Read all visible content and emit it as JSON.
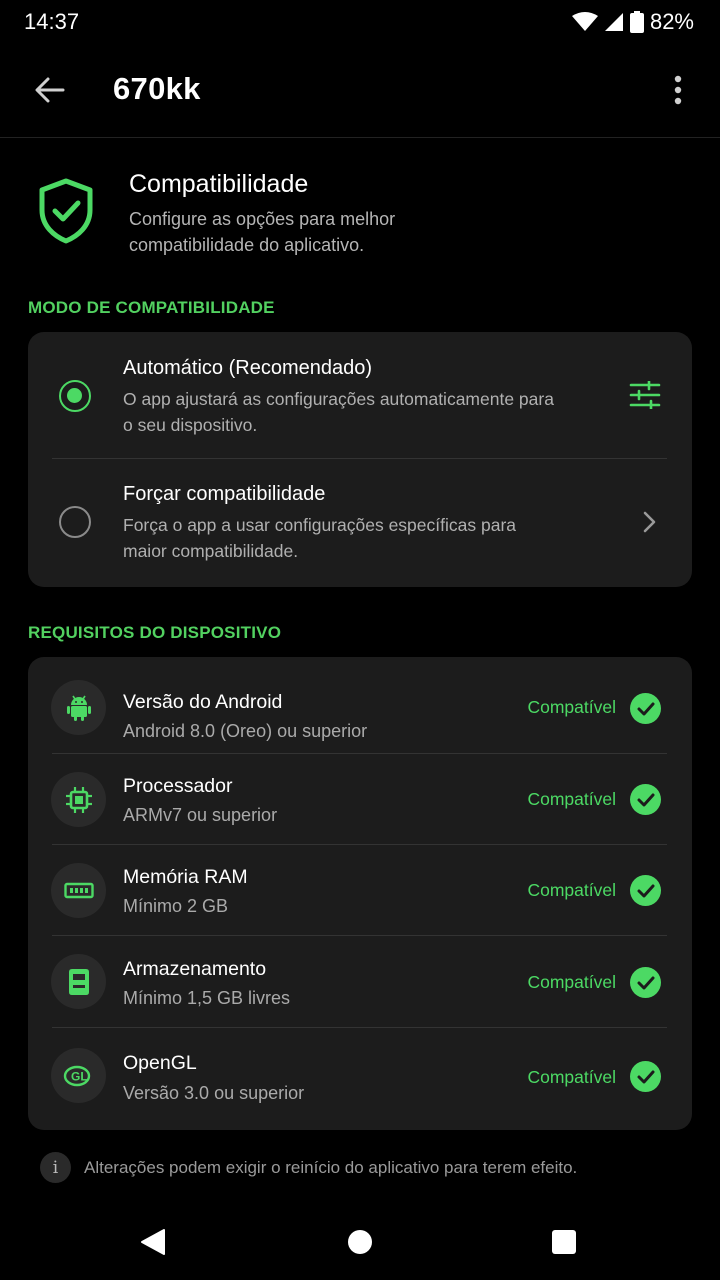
{
  "status_bar": {
    "time": "14:37",
    "battery": "82%",
    "icons": [
      "wifi-icon",
      "signal-icon",
      "battery-icon"
    ]
  },
  "app_bar": {
    "title": "670kk",
    "back_icon": "arrow-left-icon",
    "menu_icon": "more-vert-icon"
  },
  "intro": {
    "icon": "shield-check-icon",
    "title": "Compatibilidade",
    "description": "Configure as opções para melhor compatibilidade do aplicativo."
  },
  "mode_section": {
    "label": "MODO DE COMPATIBILIDADE",
    "options": [
      {
        "title": "Automático (Recomendado)",
        "description": "O app ajustará as configurações automaticamente para o seu dispositivo.",
        "selected": true,
        "trailing_icon": "tune-sliders-icon"
      },
      {
        "title": "Forçar compatibilidade",
        "description": "Força o app a usar configurações específicas para maior compatibilidade.",
        "selected": false,
        "trailing_icon": "chevron-right-icon"
      }
    ]
  },
  "requirements_section": {
    "label": "REQUISITOS DO DISPOSITIVO",
    "items": [
      {
        "icon": "android-icon",
        "title": "Versão do Android",
        "subtitle": "Android 8.0 (Oreo) ou superior",
        "status": "Compatível"
      },
      {
        "icon": "processor-chip-icon",
        "title": "Processador",
        "subtitle": "ARMv7 ou superior",
        "status": "Compatível"
      },
      {
        "icon": "memory-ram-icon",
        "title": "Memória RAM",
        "subtitle": "Mínimo 2 GB",
        "status": "Compatível"
      },
      {
        "icon": "storage-sd-icon",
        "title": "Armazenamento",
        "subtitle": "Mínimo 1,5 GB livres",
        "status": "Compatível"
      },
      {
        "icon": "opengl-icon",
        "title": "OpenGL",
        "subtitle": "Versão 3.0 ou superior",
        "status": "Compatível"
      }
    ]
  },
  "footnote": {
    "icon": "info-icon",
    "text": "Alterações podem exigir o reinício do aplicativo para terem efeito."
  },
  "nav_bar": {
    "icons": [
      "nav-back-icon",
      "nav-home-icon",
      "nav-recents-icon"
    ]
  },
  "colors": {
    "accent": "#4cd964",
    "background": "#000000",
    "card": "#1c1c1c"
  }
}
